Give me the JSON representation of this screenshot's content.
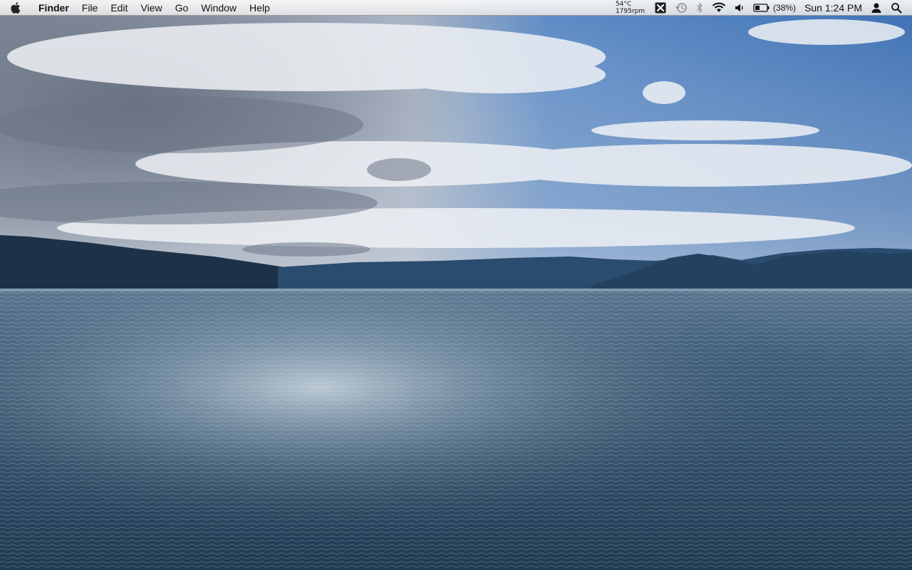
{
  "menubar": {
    "apple_icon": "apple-logo-icon",
    "app_name": "Finder",
    "menus": [
      "File",
      "Edit",
      "View",
      "Go",
      "Window",
      "Help"
    ],
    "extras": {
      "temperature": "54°C",
      "fan_speed": "1795rpm",
      "x_app_icon": "x-box-icon",
      "time_machine_icon": "time-machine-icon",
      "bluetooth_icon": "bluetooth-icon",
      "wifi_icon": "wifi-icon",
      "volume_icon": "speaker-icon",
      "battery_icon": "battery-icon",
      "battery_percent": "(38%)",
      "battery_level": 0.38,
      "clock": "Sun 1:24 PM",
      "user_icon": "user-icon",
      "spotlight_icon": "magnifier-icon"
    }
  },
  "desktop": {
    "wallpaper": "sea-and-mountains-wallpaper",
    "colors": {
      "sky_blue": "#4a78b8",
      "cloud_gray": "#8a94a4",
      "mountain": "#1e3550",
      "sea": "#2f4f66"
    }
  }
}
